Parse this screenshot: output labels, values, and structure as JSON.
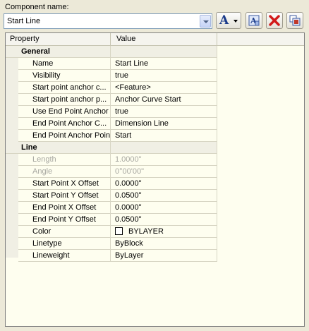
{
  "component": {
    "label": "Component name:",
    "value": "Start Line"
  },
  "toolbar": {
    "text_button_glyph": "A",
    "text_icon": "text-style-icon",
    "properties_icon": "properties-icon",
    "delete_icon": "delete-x-icon",
    "copy_icon": "copy-icon"
  },
  "grid": {
    "header": {
      "property": "Property",
      "value": "Value"
    },
    "general": {
      "title": "General",
      "rows": [
        {
          "label": "Name",
          "value": "Start Line"
        },
        {
          "label": "Visibility",
          "value": "true"
        },
        {
          "label": "Start point anchor c...",
          "value": "<Feature>"
        },
        {
          "label": "Start point anchor p...",
          "value": "Anchor Curve Start"
        },
        {
          "label": "Use End Point Anchor",
          "value": "true"
        },
        {
          "label": "End Point Anchor C...",
          "value": "Dimension Line"
        },
        {
          "label": "End Point Anchor Point",
          "value": "Start"
        }
      ]
    },
    "line": {
      "title": "Line",
      "rows": [
        {
          "label": "Length",
          "value": "1.0000\"",
          "disabled": true
        },
        {
          "label": "Angle",
          "value": "0°00'00\"",
          "disabled": true
        },
        {
          "label": "Start Point X Offset",
          "value": "0.0000\""
        },
        {
          "label": "Start Point Y Offset",
          "value": "0.0500\""
        },
        {
          "label": "End Point X Offset",
          "value": "0.0000\""
        },
        {
          "label": "End Point Y Offset",
          "value": "0.0500\""
        },
        {
          "label": "Color",
          "value": "BYLAYER",
          "swatch": "#ffffff"
        },
        {
          "label": "Linetype",
          "value": "ByBlock"
        },
        {
          "label": "Lineweight",
          "value": "ByLayer"
        }
      ]
    }
  }
}
